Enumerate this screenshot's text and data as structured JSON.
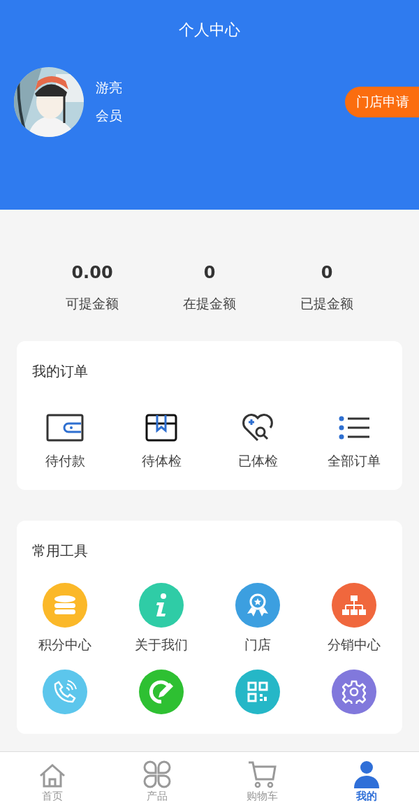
{
  "header": {
    "title": "个人中心",
    "user": {
      "name": "游亮",
      "level": "会员"
    },
    "store_apply_button": "门店申请"
  },
  "balances": [
    {
      "value": "0.00",
      "label": "可提金额"
    },
    {
      "value": "0",
      "label": "在提金额"
    },
    {
      "value": "0",
      "label": "已提金额"
    }
  ],
  "orders": {
    "title": "我的订单",
    "items": [
      {
        "kind": "wallet",
        "label": "待付款"
      },
      {
        "kind": "box",
        "label": "待体检"
      },
      {
        "kind": "heart",
        "label": "已体检"
      },
      {
        "kind": "list",
        "label": "全部订单"
      }
    ]
  },
  "tools": {
    "title": "常用工具",
    "items": [
      {
        "kind": "coins",
        "color": "#fbb828",
        "label": "积分中心"
      },
      {
        "kind": "info",
        "color": "#2fcca6",
        "label": "关于我们"
      },
      {
        "kind": "badge",
        "color": "#3c9fe0",
        "label": "门店"
      },
      {
        "kind": "tree",
        "color": "#f0673d",
        "label": "分销中心"
      },
      {
        "kind": "phone",
        "color": "#5cc6ec"
      },
      {
        "kind": "edit",
        "color": "#2ec032"
      },
      {
        "kind": "qr",
        "color": "#25b7c7"
      },
      {
        "kind": "gear",
        "color": "#8178dc"
      }
    ]
  },
  "tab_bar": [
    {
      "kind": "home",
      "label": "首页",
      "selected": false
    },
    {
      "kind": "grid",
      "label": "产品",
      "selected": false
    },
    {
      "kind": "cart",
      "label": "购物车",
      "selected": false
    },
    {
      "kind": "user",
      "label": "我的",
      "selected": true
    }
  ]
}
